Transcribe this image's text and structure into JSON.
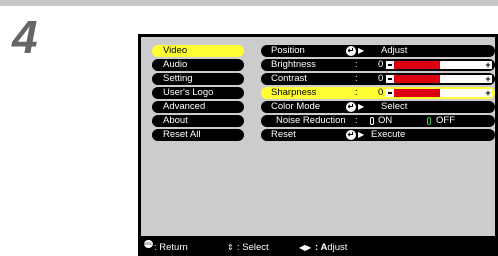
{
  "step_number": "4",
  "sidebar": {
    "items": [
      {
        "label": "Video",
        "active": true
      },
      {
        "label": "Audio"
      },
      {
        "label": "Setting"
      },
      {
        "label": "User's Logo"
      },
      {
        "label": "Advanced"
      },
      {
        "label": "About"
      },
      {
        "label": "Reset All"
      }
    ]
  },
  "settings": {
    "position": {
      "label": "Position",
      "action": "Adjust"
    },
    "brightness": {
      "label": "Brightness",
      "colon": ":",
      "value": "0",
      "plus": "+"
    },
    "contrast": {
      "label": "Contrast",
      "colon": ":",
      "value": "0",
      "plus": "+"
    },
    "sharpness": {
      "label": "Sharpness",
      "colon": ":",
      "value": "0",
      "plus": "+",
      "active": true
    },
    "color_mode": {
      "label": "Color Mode",
      "action": "Select"
    },
    "noise_reduction": {
      "label": "Noise Reduction",
      "colon": ":",
      "on": "ON",
      "off": "OFF"
    },
    "reset": {
      "label": "Reset",
      "action": "Execute"
    }
  },
  "footer": {
    "esc_icon_text": "ESC",
    "return": ": Return",
    "select": ": Select",
    "adjust_prefix": ": A",
    "adjust_rest": "djust"
  },
  "icons": {
    "enter": "enter-icon",
    "esc": "esc-icon",
    "updown": "updown-arrow-icon",
    "leftright": "leftright-arrow-icon"
  },
  "colors": {
    "highlight": "#ffff33",
    "slider_fill": "#dd0011",
    "menu_bg": "#000000",
    "panel_bg": "#cccccc",
    "off_indicator": "#34c24a"
  }
}
